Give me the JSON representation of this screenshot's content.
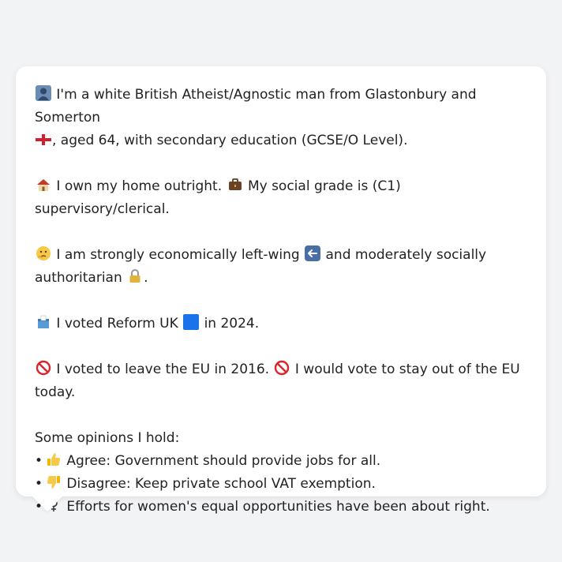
{
  "profile": {
    "line1_icon": "bust-in-silhouette-icon",
    "line1_text_a": "I'm a white British Atheist/Agnostic man from Glastonbury and Somerton",
    "line1_flag_icon": "england-flag-icon",
    "line1_text_b": ", aged 64, with secondary education (GCSE/O Level).",
    "home_icon": "house-icon",
    "home_text": "I own my home outright.",
    "work_icon": "briefcase-icon",
    "work_text": "My social grade is (C1) supervisory/clerical.",
    "thinking_icon": "thinking-face-icon",
    "econ_text": "I am strongly economically left-wing",
    "left_arrow_icon": "left-arrow-icon",
    "social_text": "and moderately socially authoritarian",
    "lock_icon": "lock-icon",
    "ballot_icon": "ballot-box-icon",
    "vote_text_a": "I voted Reform UK",
    "party_color_icon": "blue-square-icon",
    "party_color": "#1a73e8",
    "vote_text_b": "in 2024.",
    "eu_icon_1": "no-entry-icon",
    "eu_text_1": "I voted to leave the EU in 2016.",
    "eu_icon_2": "no-entry-icon",
    "eu_text_2": "I would vote to stay out of the EU today.",
    "opinions_heading": "Some opinions I hold:",
    "opinions": [
      {
        "bullet": "•",
        "icon": "thumbs-up-icon",
        "text": "Agree: Government should provide jobs for all."
      },
      {
        "bullet": "•",
        "icon": "thumbs-down-icon",
        "text": "Disagree: Keep private school VAT exemption."
      },
      {
        "bullet": "•",
        "icon": "female-sign-icon",
        "text": "Efforts for women's equal opportunities have been about right."
      }
    ]
  }
}
